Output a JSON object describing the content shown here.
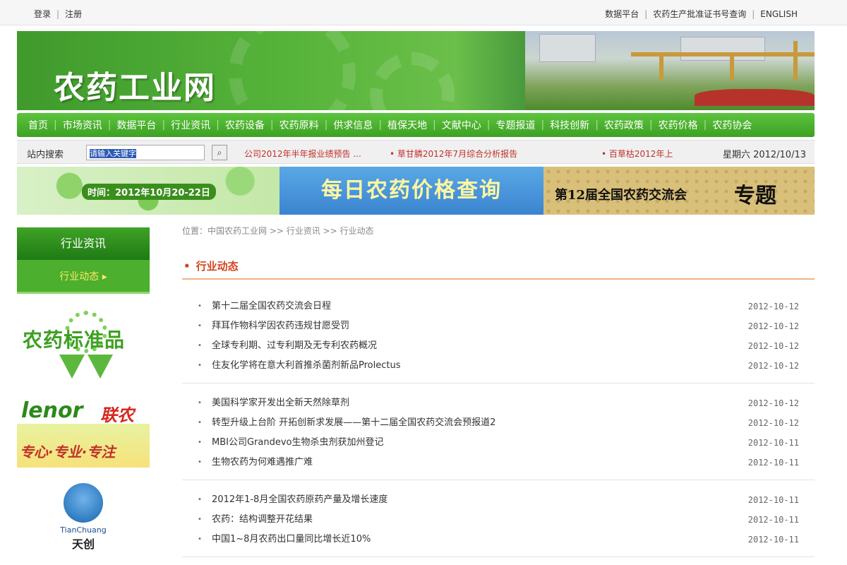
{
  "topbar": {
    "login": "登录",
    "register": "注册",
    "data_platform": "数据平台",
    "registration_query": "农药生产批准证书号查询",
    "english": "ENGLISH"
  },
  "banner": {
    "logo_text": "农药工业网"
  },
  "nav": {
    "items": [
      "首页",
      "市场资讯",
      "数据平台",
      "行业资讯",
      "农药设备",
      "农药原料",
      "供求信息",
      "植保天地",
      "文献中心",
      "专题报道",
      "科技创新",
      "农药政策",
      "农药价格",
      "农药协会"
    ]
  },
  "search": {
    "label": "站内搜索",
    "input_value": "请输入关键字",
    "news_1": "公司2012年半年报业绩预告 ...",
    "news_2": "• 草甘膦2012年7月综合分析报告",
    "news_3": "• 百草枯2012年上",
    "date": "星期六 2012/10/13"
  },
  "ads": {
    "ad1_time": "时间：2012年10月20-22日",
    "ad2_text": "每日农药价格查询",
    "ad3_text": "第12届全国农药交流会",
    "ad3_tag": "专题"
  },
  "sidebar": {
    "title": "行业资讯",
    "sub": "行业动态 ▸",
    "badge1_text": "农药标准品",
    "badge2_lenor": "lenor",
    "badge2_cn": "联农",
    "badge2_slogan": "专心·专业·专注",
    "badge3_en": "TianChuang",
    "badge3_cn": "天创"
  },
  "main": {
    "breadcrumb": "位置：中国农药工业网 >> 行业资讯 >> 行业动态",
    "section_title": "行业动态",
    "groups": [
      [
        {
          "title": "第十二届全国农药交流会日程",
          "date": "2012-10-12"
        },
        {
          "title": "拜耳作物科学因农药违规甘愿受罚",
          "date": "2012-10-12"
        },
        {
          "title": "全球专利期、过专利期及无专利农药概况",
          "date": "2012-10-12"
        },
        {
          "title": "住友化学将在意大利首推杀菌剂新品Prolectus",
          "date": "2012-10-12"
        }
      ],
      [
        {
          "title": "美国科学家开发出全新天然除草剂",
          "date": "2012-10-12"
        },
        {
          "title": "转型升级上台阶 开拓创新求发展——第十二届全国农药交流会预报道2",
          "date": "2012-10-12"
        },
        {
          "title": "MBI公司Grandevo生物杀虫剂获加州登记",
          "date": "2012-10-11"
        },
        {
          "title": "生物农药为何难遇推广难",
          "date": "2012-10-11"
        }
      ],
      [
        {
          "title": "2012年1-8月全国农药原药产量及增长速度",
          "date": "2012-10-11"
        },
        {
          "title": "农药：结构调整开花结果",
          "date": "2012-10-11"
        },
        {
          "title": "中国1~8月农药出口量同比增长近10%",
          "date": "2012-10-11"
        }
      ]
    ]
  }
}
